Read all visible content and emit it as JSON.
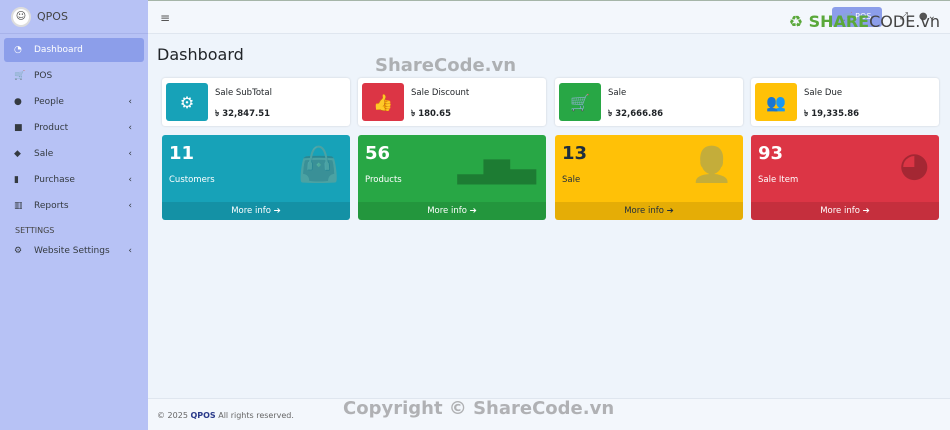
{
  "app": {
    "name": "QPOS"
  },
  "sidebar": {
    "items": [
      {
        "label": "Dashboard",
        "icon": "tachometer-icon",
        "glyph": "◔",
        "active": true,
        "chevron": false
      },
      {
        "label": "POS",
        "icon": "cart-plus-icon",
        "glyph": "🛒",
        "chevron": false
      },
      {
        "label": "People",
        "icon": "user-circle-icon",
        "glyph": "●",
        "chevron": true
      },
      {
        "label": "Product",
        "icon": "box-icon",
        "glyph": "■",
        "chevron": true
      },
      {
        "label": "Sale",
        "icon": "tags-icon",
        "glyph": "◆",
        "chevron": true
      },
      {
        "label": "Purchase",
        "icon": "shopping-bag-icon",
        "glyph": "▮",
        "chevron": true
      },
      {
        "label": "Reports",
        "icon": "chart-bar-icon",
        "glyph": "▥",
        "chevron": true
      }
    ],
    "section": "SETTINGS",
    "settings": {
      "label": "Website Settings",
      "icon": "cog-icon",
      "glyph": "⚙"
    }
  },
  "topbar": {
    "pos_button": "POS"
  },
  "page": {
    "title": "Dashboard"
  },
  "info_boxes": [
    {
      "label": "Sale SubTotal",
      "value": "৳ 32,847.51",
      "color": "#17a2b8",
      "icon": "cog-icon",
      "glyph": "⚙"
    },
    {
      "label": "Sale Discount",
      "value": "৳ 180.65",
      "color": "#dc3545",
      "icon": "thumbs-up-icon",
      "glyph": "👍"
    },
    {
      "label": "Sale",
      "value": "৳ 32,666.86",
      "color": "#28a745",
      "icon": "shopping-cart-icon",
      "glyph": "🛒"
    },
    {
      "label": "Sale Due",
      "value": "৳ 19,335.86",
      "color": "#ffc107",
      "icon": "users-icon",
      "glyph": "👥"
    }
  ],
  "small_boxes": [
    {
      "number": "11",
      "label": "Customers",
      "more": "More info ➔",
      "color": "#17a2b8",
      "icon": "shopping-bag-icon",
      "glyph": "👜"
    },
    {
      "number": "56",
      "label": "Products",
      "more": "More info ➔",
      "color": "#28a745",
      "icon": "chart-bar-icon",
      "glyph": "▂▅▃"
    },
    {
      "number": "13",
      "label": "Sale",
      "more": "More info ➔",
      "color": "#ffc107",
      "icon": "user-plus-icon",
      "glyph": "👤"
    },
    {
      "number": "93",
      "label": "Sale Item",
      "more": "More info ➔",
      "color": "#dc3545",
      "icon": "pie-chart-icon",
      "glyph": "◕"
    }
  ],
  "footer": {
    "prefix": "© 2025",
    "brand": "QPOS",
    "suffix": "All rights reserved."
  },
  "watermarks": {
    "top": "ShareCode.vn",
    "bottom": "Copyright © ShareCode.vn",
    "logo_a": "SHARE",
    "logo_b": "CODE.vn"
  }
}
